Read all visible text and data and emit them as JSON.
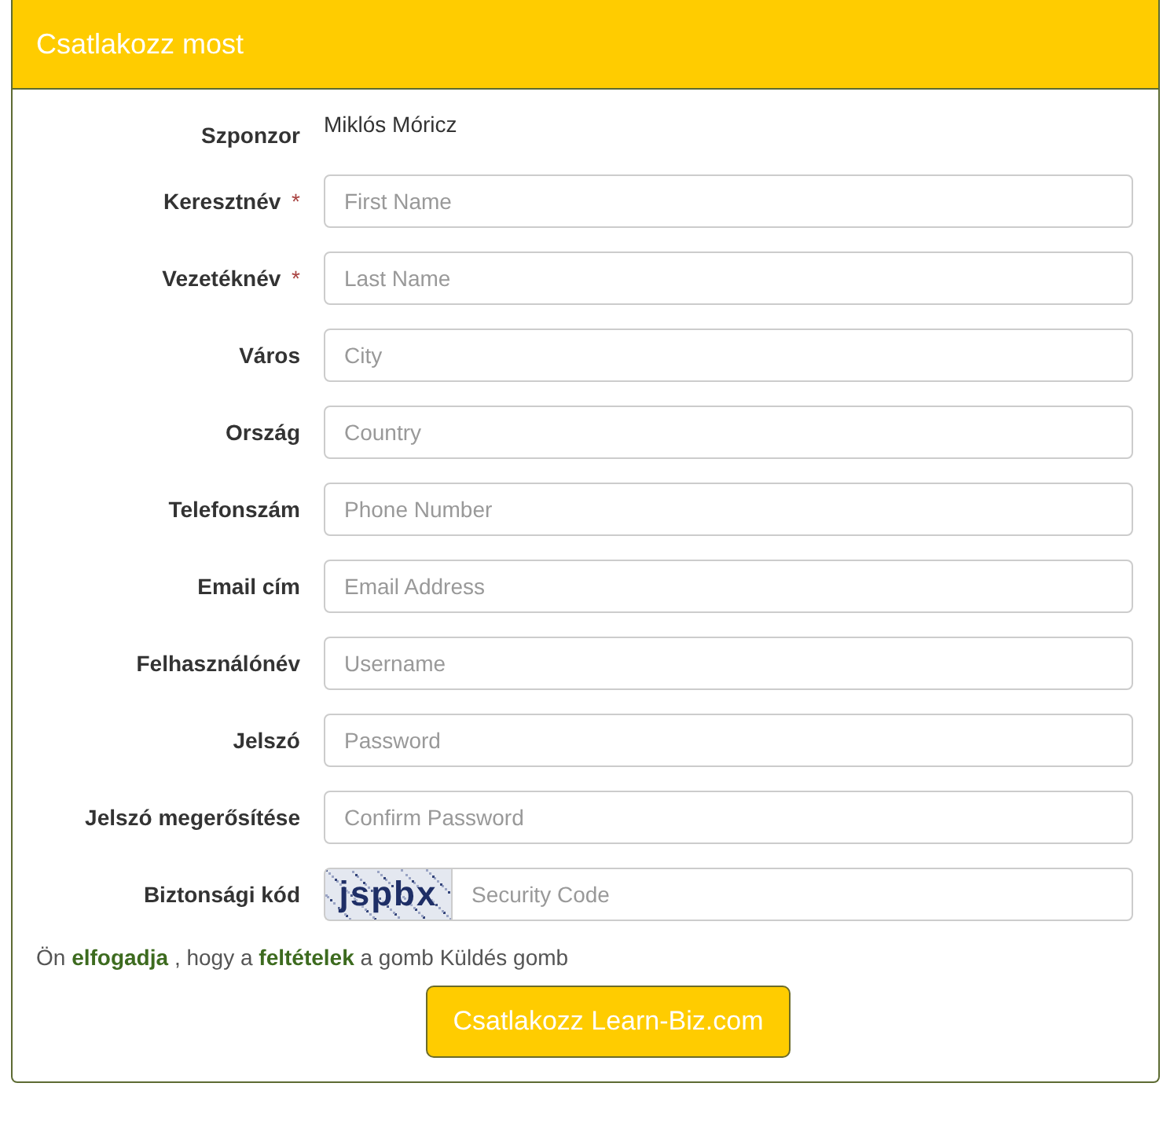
{
  "panel": {
    "title": "Csatlakozz most"
  },
  "required_mark": "*",
  "fields": [
    {
      "kind": "static",
      "label": "Szponzor",
      "required": false,
      "value": "Miklós Móricz"
    },
    {
      "kind": "input",
      "label": "Keresztnév",
      "required": true,
      "placeholder": "First Name"
    },
    {
      "kind": "input",
      "label": "Vezetéknév",
      "required": true,
      "placeholder": "Last Name"
    },
    {
      "kind": "input",
      "label": "Város",
      "required": false,
      "placeholder": "City"
    },
    {
      "kind": "input",
      "label": "Ország",
      "required": false,
      "placeholder": "Country"
    },
    {
      "kind": "input",
      "label": "Telefonszám",
      "required": false,
      "placeholder": "Phone Number"
    },
    {
      "kind": "input",
      "label": "Email cím",
      "required": false,
      "placeholder": "Email Address"
    },
    {
      "kind": "input",
      "label": "Felhasználónév",
      "required": false,
      "placeholder": "Username"
    },
    {
      "kind": "input",
      "label": "Jelszó",
      "required": false,
      "placeholder": "Password"
    },
    {
      "kind": "input",
      "label": "Jelszó megerősítése",
      "required": false,
      "placeholder": "Confirm Password"
    },
    {
      "kind": "captcha",
      "label": "Biztonsági kód",
      "required": false,
      "captcha": "jspbx",
      "placeholder": "Security Code"
    }
  ],
  "terms": [
    {
      "kind": "text",
      "text": "Ön"
    },
    {
      "kind": "link",
      "text": "elfogadja"
    },
    {
      "kind": "text",
      "text": ", hogy a"
    },
    {
      "kind": "link",
      "text": "feltételek"
    },
    {
      "kind": "text",
      "text": "a gomb Küldés gomb"
    }
  ],
  "submit": {
    "label": "Csatlakozz Learn-Biz.com"
  }
}
